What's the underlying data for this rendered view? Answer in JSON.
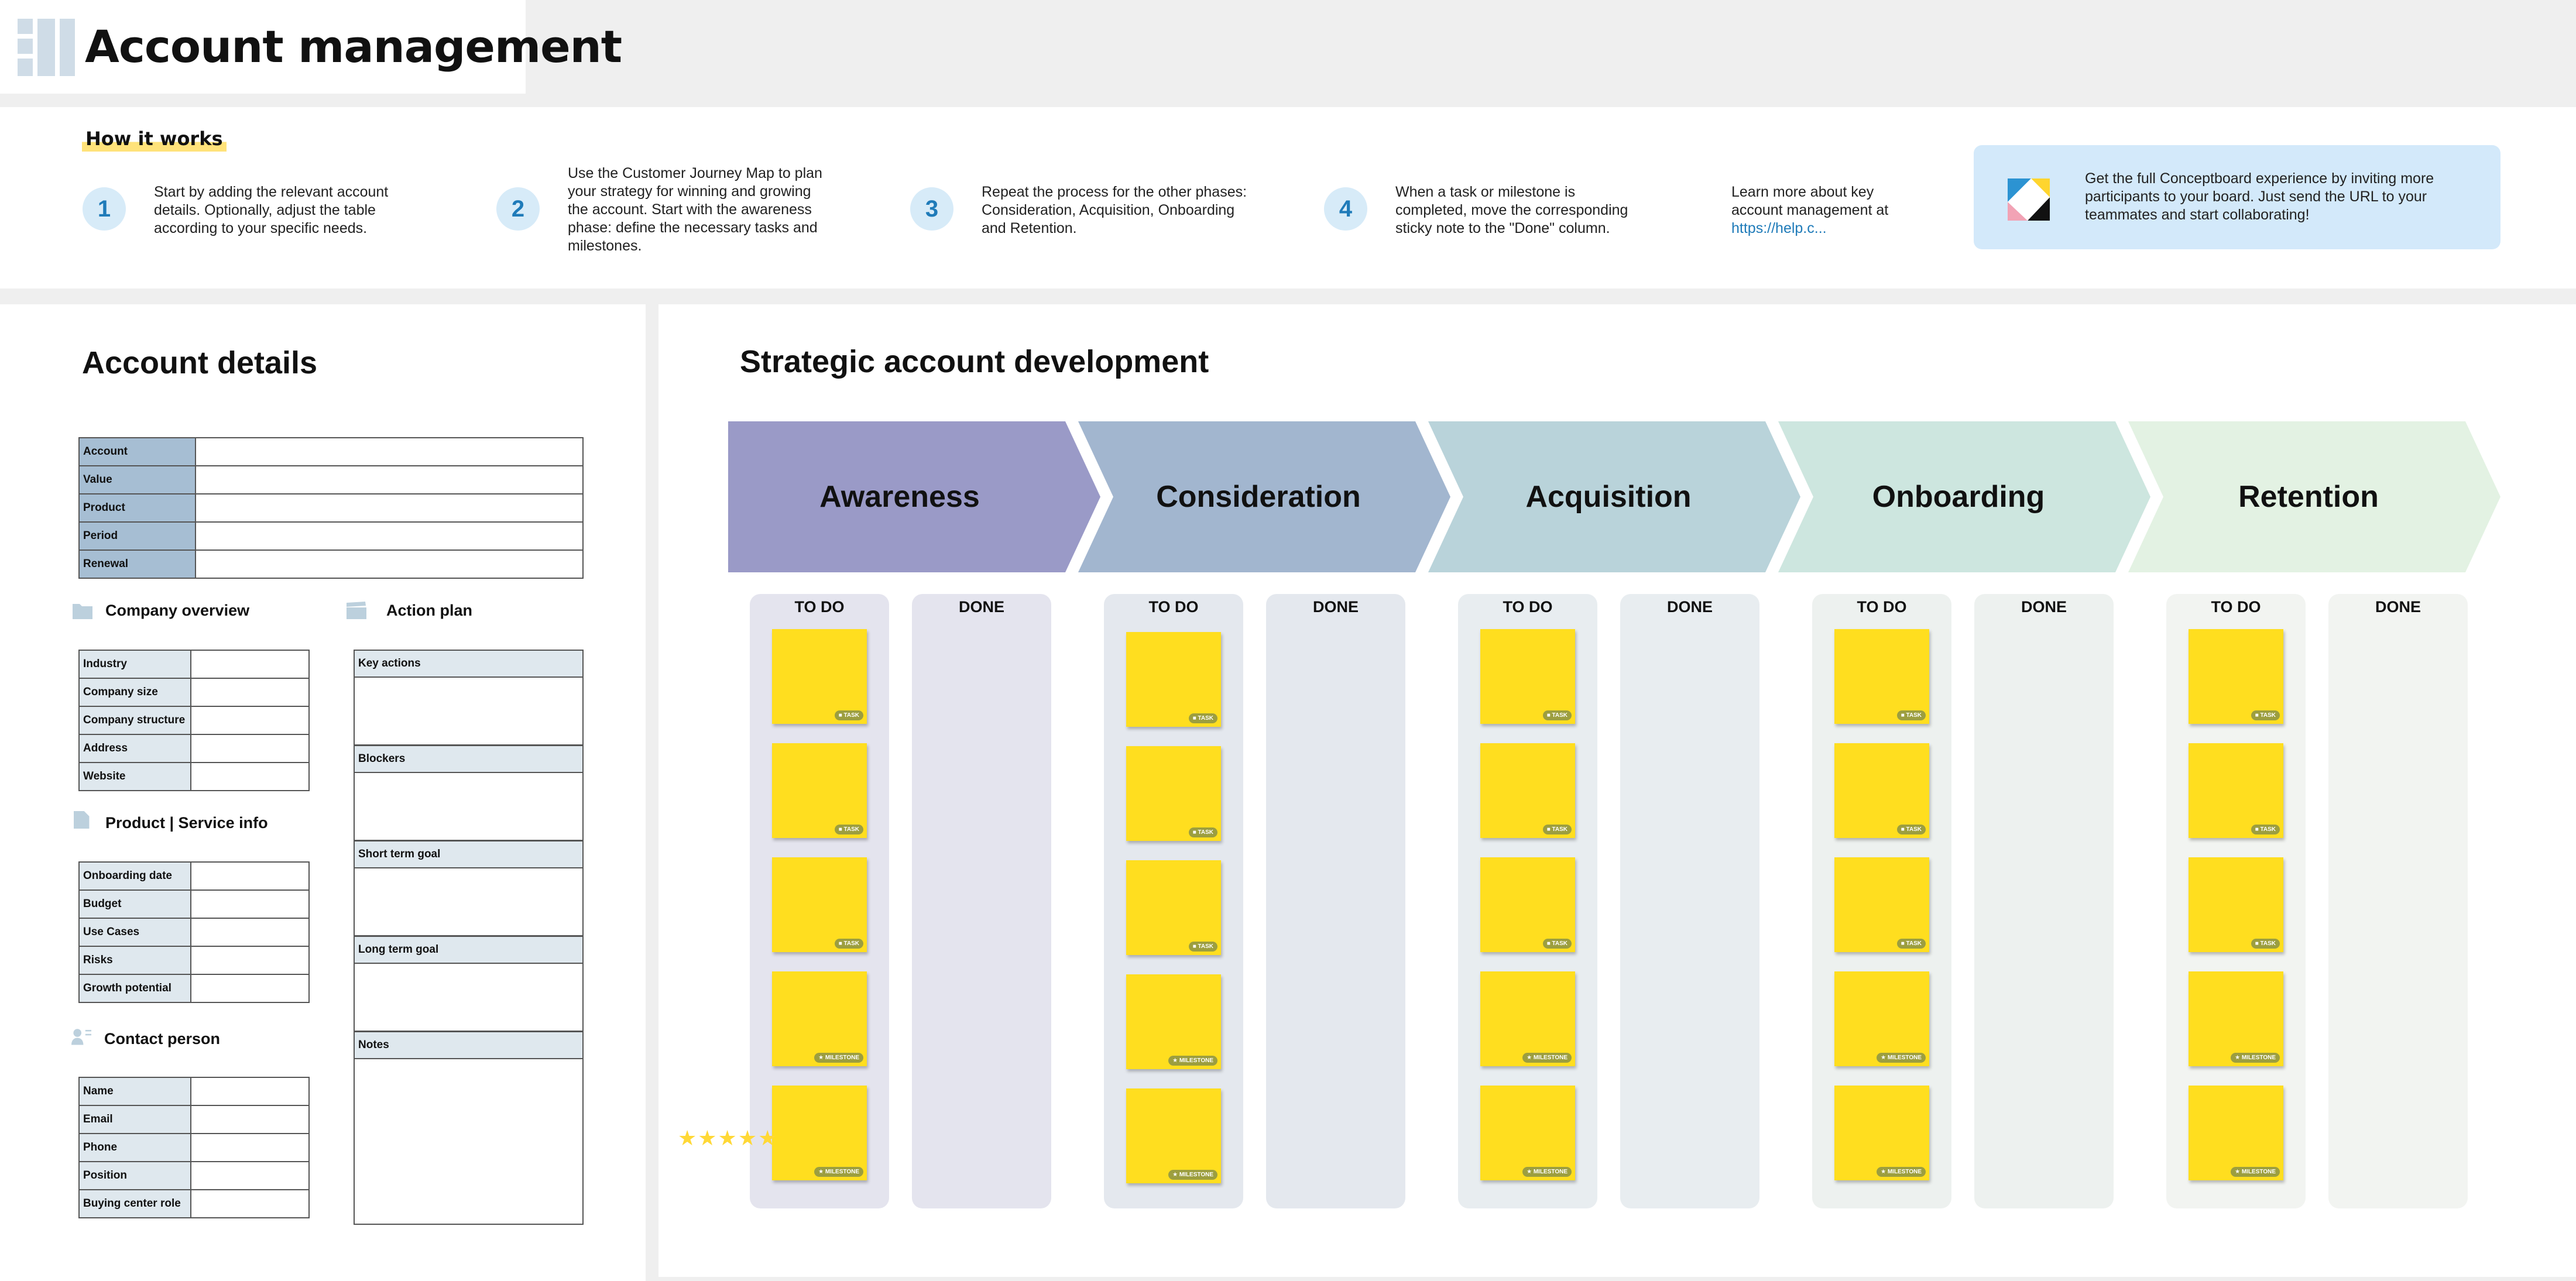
{
  "title": "Account management",
  "how_it_works": {
    "heading": "How it works",
    "steps": [
      {
        "num": "1",
        "text": "Start by adding the relevant account details. Optionally, adjust the table according to your specific needs."
      },
      {
        "num": "2",
        "text": "Use the Customer Journey Map to plan your strategy for winning and growing the account. Start with the awareness phase: define the necessary tasks and milestones."
      },
      {
        "num": "3",
        "text": "Repeat the process for the other phases: Consideration, Acquisition, Onboarding and Retention."
      },
      {
        "num": "4",
        "text": "When a task or milestone is completed, move the corresponding sticky note to the \"Done\" column."
      }
    ],
    "learn_more_text": "Learn more about key account management at",
    "learn_more_link": "https://help.c...",
    "invite_text": "Get the full Conceptboard experience by inviting more participants to your board. Just send the URL to your teammates and start collaborating!"
  },
  "account_details": {
    "title": "Account details",
    "account_fields": [
      "Account",
      "Value",
      "Product",
      "Period",
      "Renewal"
    ],
    "company_overview": {
      "heading": "Company overview",
      "fields": [
        "Industry",
        "Company size",
        "Company structure",
        "Address",
        "Website"
      ]
    },
    "action_plan": {
      "heading": "Action plan",
      "blocks": [
        "Key actions",
        "Blockers",
        "Short term goal",
        "Long term goal",
        "Notes"
      ]
    },
    "product_info": {
      "heading": "Product | Service info",
      "fields": [
        "Onboarding date",
        "Budget",
        "Use Cases",
        "Risks",
        "Growth potential"
      ]
    },
    "contact_person": {
      "heading": "Contact person",
      "fields": [
        "Name",
        "Email",
        "Phone",
        "Position",
        "Buying center role"
      ]
    }
  },
  "strategy": {
    "title": "Strategic account development",
    "todo_label": "TO DO",
    "done_label": "DONE",
    "task_label": "TASK",
    "milestone_label": "MILESTONE",
    "rating_stars": 5,
    "phases": [
      {
        "name": "Awareness",
        "color": "#9a9ac7",
        "column_color": "#e4e4ee"
      },
      {
        "name": "Consideration",
        "color": "#a2b6cf",
        "column_color": "#e4e8ee"
      },
      {
        "name": "Acquisition",
        "color": "#b9d3da",
        "column_color": "#e8edf0"
      },
      {
        "name": "Onboarding",
        "color": "#cde6df",
        "column_color": "#edf1ef"
      },
      {
        "name": "Retention",
        "color": "#e3f2e3",
        "column_color": "#f2f4f1"
      }
    ]
  },
  "colors": {
    "sticky_note": "#ffde1f",
    "step_accent": "#1f7bb9",
    "invite_box": "#d3e9fa"
  }
}
